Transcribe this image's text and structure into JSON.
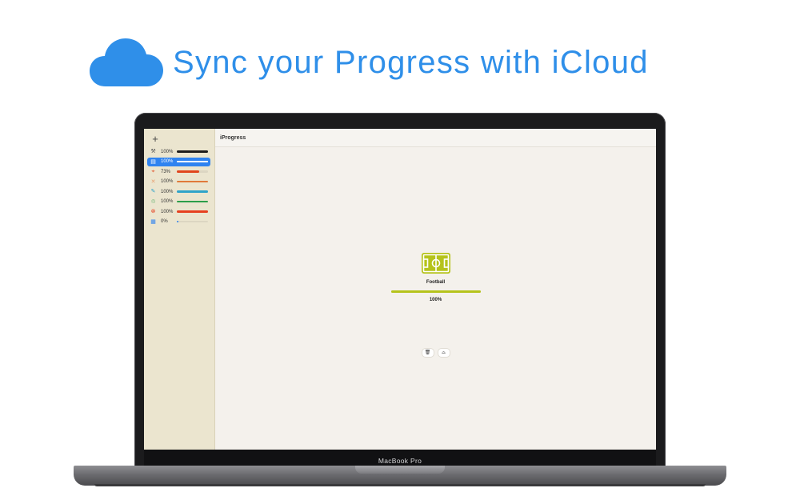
{
  "headline": {
    "text": "Sync your Progress with iCloud",
    "icon": "cloud-icon",
    "color": "#2f8fe9"
  },
  "laptop": {
    "model_label": "MacBook Pro"
  },
  "app": {
    "title": "iProgress",
    "add_label": "+",
    "items": [
      {
        "icon": "tools-icon",
        "pct_label": "100%",
        "progress": 100,
        "color": "#1c1c1c",
        "icon_color": "#555555",
        "glyph": "⚒",
        "selected": false
      },
      {
        "icon": "football-pitch-icon",
        "pct_label": "100%",
        "progress": 100,
        "color": "#ffffff",
        "icon_color": "#b5c31b",
        "glyph": "▤",
        "selected": true
      },
      {
        "icon": "target-icon",
        "pct_label": "73%",
        "progress": 73,
        "color": "#e0461d",
        "icon_color": "#e0461d",
        "glyph": "⌖",
        "selected": false
      },
      {
        "icon": "cross-icon",
        "pct_label": "100%",
        "progress": 100,
        "color": "#e07a3a",
        "icon_color": "#e8a070",
        "glyph": "✕",
        "selected": false
      },
      {
        "icon": "pencil-icon",
        "pct_label": "100%",
        "progress": 100,
        "color": "#2fa3c9",
        "icon_color": "#2fa3c9",
        "glyph": "✎",
        "selected": false
      },
      {
        "icon": "recycle-icon",
        "pct_label": "100%",
        "progress": 100,
        "color": "#2c9e4a",
        "icon_color": "#2c9e4a",
        "glyph": "♲",
        "selected": false
      },
      {
        "icon": "close-circle-icon",
        "pct_label": "100%",
        "progress": 100,
        "color": "#e6401f",
        "icon_color": "#e6401f",
        "glyph": "⊗",
        "selected": false
      },
      {
        "icon": "calendar-icon",
        "pct_label": "0%",
        "progress": 0,
        "color": "#2f83f0",
        "icon_color": "#2f83f0",
        "glyph": "▦",
        "selected": false
      }
    ],
    "detail": {
      "name": "Football",
      "pct_label": "100%",
      "progress": 100,
      "color": "#b5c31b",
      "icon": "football-pitch-icon"
    },
    "actions": [
      {
        "icon": "trash-icon",
        "glyph": "🗑"
      },
      {
        "icon": "tray-icon",
        "glyph": "⌓"
      }
    ]
  }
}
